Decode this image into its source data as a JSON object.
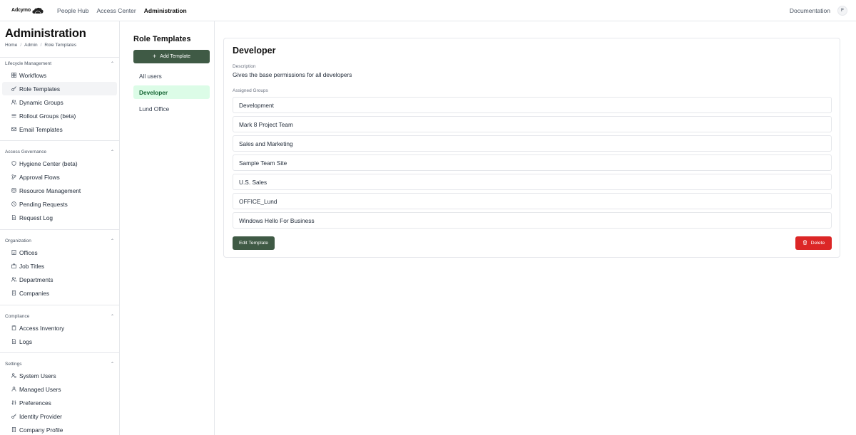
{
  "topnav": {
    "brand": "Adcymo",
    "links": [
      "People Hub",
      "Access Center",
      "Administration"
    ],
    "active": "Administration",
    "documentation": "Documentation",
    "avatar_initial": "F"
  },
  "sidebar": {
    "title": "Administration",
    "breadcrumb": [
      "Home",
      "Admin",
      "Role Templates"
    ],
    "sections": [
      {
        "header": "Lifecycle Management",
        "items": [
          {
            "label": "Workflows",
            "icon": "grid-icon"
          },
          {
            "label": "Role Templates",
            "icon": "key-icon",
            "active": true
          },
          {
            "label": "Dynamic Groups",
            "icon": "users-icon"
          },
          {
            "label": "Rollout Groups (beta)",
            "icon": "sliders-icon"
          },
          {
            "label": "Email Templates",
            "icon": "mail-icon"
          }
        ]
      },
      {
        "header": "Access Governance",
        "items": [
          {
            "label": "Hygiene Center (beta)",
            "icon": "shield-icon"
          },
          {
            "label": "Approval Flows",
            "icon": "branch-icon"
          },
          {
            "label": "Resource Management",
            "icon": "database-icon"
          },
          {
            "label": "Pending Requests",
            "icon": "clock-icon"
          },
          {
            "label": "Request Log",
            "icon": "file-icon"
          }
        ]
      },
      {
        "header": "Organization",
        "items": [
          {
            "label": "Offices",
            "icon": "building-icon"
          },
          {
            "label": "Job Titles",
            "icon": "briefcase-icon"
          },
          {
            "label": "Departments",
            "icon": "users-icon"
          },
          {
            "label": "Companies",
            "icon": "building-icon"
          }
        ]
      },
      {
        "header": "Compliance",
        "items": [
          {
            "label": "Access Inventory",
            "icon": "clipboard-icon"
          },
          {
            "label": "Logs",
            "icon": "file-icon"
          }
        ]
      },
      {
        "header": "Settings",
        "items": [
          {
            "label": "System Users",
            "icon": "user-cog-icon"
          },
          {
            "label": "Managed Users",
            "icon": "user-icon"
          },
          {
            "label": "Preferences",
            "icon": "sliders-icon"
          },
          {
            "label": "Identity Provider",
            "icon": "key-icon"
          },
          {
            "label": "Company Profile",
            "icon": "building-icon"
          }
        ]
      }
    ]
  },
  "templates": {
    "title": "Role Templates",
    "add_label": "Add Template",
    "items": [
      "All users",
      "Developer",
      "Lund Office"
    ],
    "selected": "Developer"
  },
  "detail": {
    "title": "Developer",
    "description_label": "Description",
    "description": "Gives the base permissions for all developers",
    "groups_label": "Assigned Groups",
    "groups": [
      "Development",
      "Mark 8 Project Team",
      "Sales and Marketing",
      "Sample Team Site",
      "U.S. Sales",
      "OFFICE_Lund",
      "Windows Hello For Business"
    ],
    "edit_label": "Edit Template",
    "delete_label": "Delete"
  },
  "colors": {
    "primary": "#3f5a45",
    "danger": "#dc2626",
    "selected_bg": "#dcfce7",
    "selected_text": "#166534"
  }
}
